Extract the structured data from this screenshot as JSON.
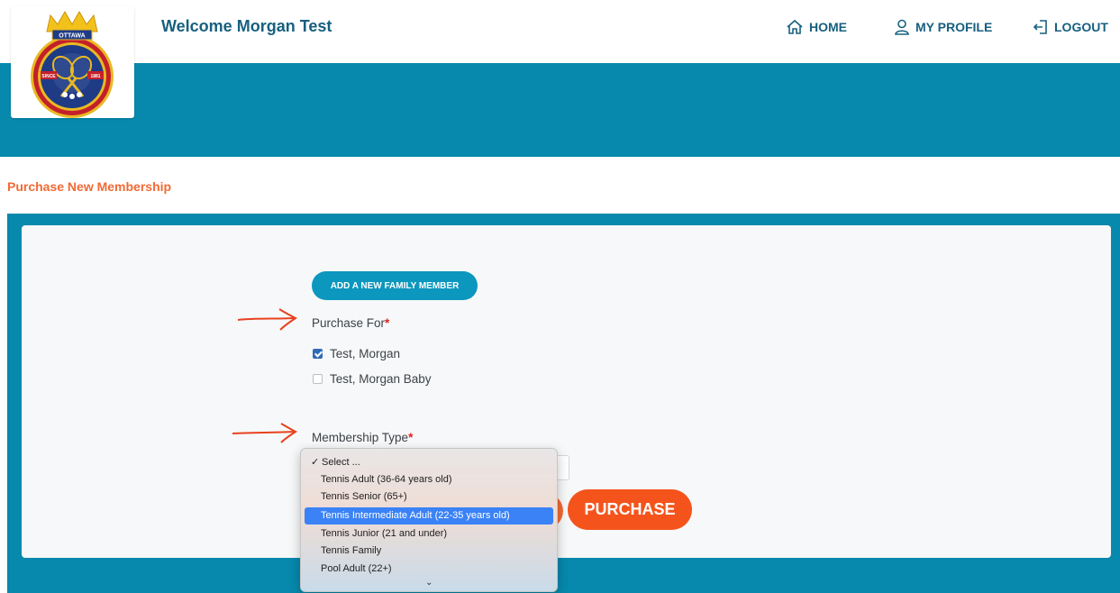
{
  "header": {
    "welcome": "Welcome Morgan Test",
    "nav": [
      {
        "label": "HOME",
        "icon": "home-icon"
      },
      {
        "label": "MY PROFILE",
        "icon": "user-icon"
      },
      {
        "label": "LOGOUT",
        "icon": "logout-icon"
      }
    ],
    "logo": {
      "top_text": "OTTAWA",
      "ring_text": "TENNIS AND LAWN BOWLING CLUB",
      "since_left": "SINCE",
      "since_right": "1881"
    }
  },
  "page": {
    "title": "Purchase New Membership"
  },
  "form": {
    "add_member_label": "ADD A NEW FAMILY MEMBER",
    "purchase_for_label": "Purchase For",
    "required_mark": "*",
    "members": [
      {
        "name": "Test, Morgan",
        "checked": true
      },
      {
        "name": "Test, Morgan Baby",
        "checked": false
      }
    ],
    "membership_type_label": "Membership Type",
    "purchase_label": "PURCHASE"
  },
  "dropdown": {
    "options": [
      "Select ...",
      "Tennis Adult (36-64 years old)",
      "Tennis Senior (65+)",
      "Tennis Intermediate Adult (22-35 years old)",
      "Tennis Junior (21 and under)",
      "Tennis Family",
      "Pool Adult (22+)"
    ],
    "selected_index": 0,
    "highlighted_index": 3,
    "check_mark": "✓",
    "more_arrow": "⌄"
  },
  "colors": {
    "brand_teal": "#0689ac",
    "accent_orange": "#f4541c",
    "title_blue": "#17607f"
  }
}
